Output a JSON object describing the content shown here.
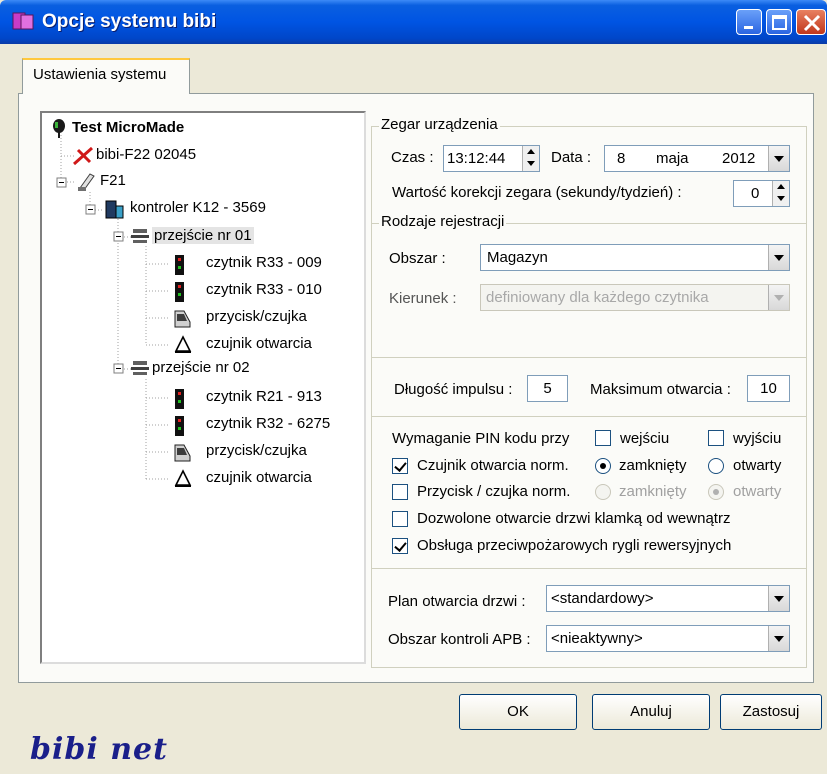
{
  "window": {
    "title": "Opcje systemu bibi"
  },
  "tab": {
    "label": "Ustawienia systemu"
  },
  "tree": {
    "root": "Test MicroMade",
    "items": [
      "bibi-F22 02045",
      "F21",
      "kontroler K12 - 3569",
      "przejście nr 01",
      "czytnik R33 - 009",
      "czytnik R33 - 010",
      "przycisk/czujka",
      "czujnik otwarcia",
      "przejście nr 02",
      "czytnik R21 - 913",
      "czytnik R32 - 6275",
      "przycisk/czujka",
      "czujnik otwarcia"
    ]
  },
  "clock": {
    "group_title": "Zegar urządzenia",
    "time_label": "Czas :",
    "time_value": "13:12:44",
    "date_label": "Data :",
    "date_day": "8",
    "date_month": "maja",
    "date_year": "2012",
    "correction_label": "Wartość korekcji zegara (sekundy/tydzień) :",
    "correction_value": "0"
  },
  "registration": {
    "group_title": "Rodzaje rejestracji",
    "area_label": "Obszar :",
    "area_value": "Magazyn",
    "direction_label": "Kierunek :",
    "direction_value": "definiowany dla każdego czytnika"
  },
  "impulse": {
    "length_label": "Długość impulsu :",
    "length_value": "5",
    "max_open_label": "Maksimum otwarcia :",
    "max_open_value": "10"
  },
  "options": {
    "pin_label": "Wymaganie PIN kodu przy",
    "pin_entry": "wejściu",
    "pin_exit": "wyjściu",
    "sensor_label": "Czujnik otwarcia  norm.",
    "sensor_closed": "zamknięty",
    "sensor_open": "otwarty",
    "button_label": "Przycisk / czujka norm.",
    "button_closed": "zamknięty",
    "button_open": "otwarty",
    "handle_label": "Dozwolone otwarcie drzwi klamką od wewnątrz",
    "fire_label": "Obsługa przeciwpożarowych rygli rewersyjnych"
  },
  "plans": {
    "door_plan_label": "Plan otwarcia drzwi :",
    "door_plan_value": "<standardowy>",
    "apb_label": "Obszar kontroli APB :",
    "apb_value": "<nieaktywny>"
  },
  "buttons": {
    "ok": "OK",
    "cancel": "Anuluj",
    "apply": "Zastosuj"
  },
  "logo": "bibi net"
}
